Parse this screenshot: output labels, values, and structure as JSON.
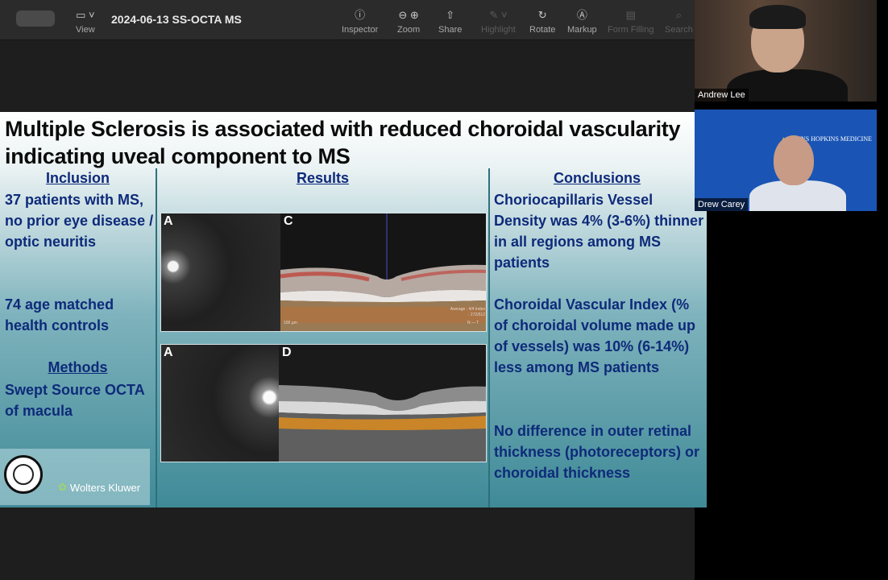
{
  "window": {
    "title": "2024-06-13 SS-OCTA MS",
    "toolbar": [
      {
        "label": "View",
        "icon": "sidebar-icon",
        "enabled": true
      },
      {
        "label": "Inspector",
        "icon": "info-icon",
        "enabled": true
      },
      {
        "label": "Zoom",
        "icon": "zoom-icon",
        "enabled": true
      },
      {
        "label": "Share",
        "icon": "share-icon",
        "enabled": true
      },
      {
        "label": "Highlight",
        "icon": "highlighter-icon",
        "enabled": false
      },
      {
        "label": "Rotate",
        "icon": "rotate-icon",
        "enabled": true
      },
      {
        "label": "Markup",
        "icon": "markup-icon",
        "enabled": true
      },
      {
        "label": "Form Filling",
        "icon": "form-icon",
        "enabled": false
      },
      {
        "label": "Search",
        "icon": "search-icon",
        "enabled": false
      }
    ]
  },
  "slide": {
    "title": "Multiple Sclerosis is associated with reduced choroidal vascularity indicating uveal component to MS",
    "inclusion": {
      "heading": "Inclusion",
      "text1": "37 patients with MS, no prior eye disease / optic neuritis",
      "text2": "74 age matched health controls"
    },
    "methods": {
      "heading": "Methods",
      "text": "Swept Source OCTA of macula"
    },
    "results": {
      "heading": "Results",
      "fig1_left": "A",
      "fig1_right": "C",
      "fig1_scale": "100 µm",
      "fig1_info": "Average : 4/4 Index : 272/512",
      "fig1_orient": "N — T",
      "fig2_left": "A",
      "fig2_right": "D"
    },
    "conclusions": {
      "heading": "Conclusions",
      "text1": "Choriocapillaris Vessel Density was 4% (3-6%) thinner in all regions among MS patients",
      "text2": "Choroidal Vascular Index (% of choroidal volume made up of vessels) was 10% (6-14%) less among MS patients",
      "text3": "No difference in outer retinal thickness (photoreceptors) or choroidal thickness"
    },
    "publisher": "Wolters Kluwer"
  },
  "participants": [
    {
      "name": "Andrew Lee"
    },
    {
      "name": "Drew Carey",
      "org_logo": "JOHNS HOPKINS MEDICINE"
    }
  ],
  "colors": {
    "slide_text": "#0e2a7a",
    "toolbar_bg": "#2b2b2b",
    "teal": "#3f8a97",
    "tile_blue": "#1a55b5"
  }
}
